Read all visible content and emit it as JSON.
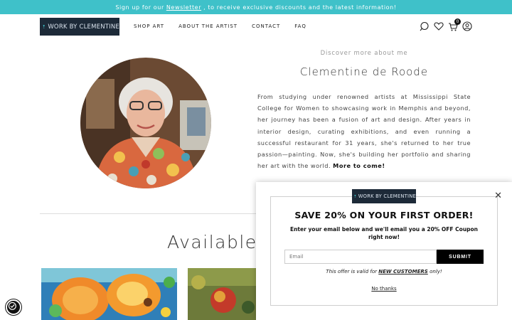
{
  "announcement": {
    "prefix": "Sign up for our",
    "link": "Newsletter",
    "suffix": ", to receive exclusive discounts and the latest information!"
  },
  "brand": {
    "logo_text": "WORK BY CLEMENTINE",
    "color": "#1d2a38"
  },
  "nav": [
    {
      "label": "SHOP ART"
    },
    {
      "label": "ABOUT THE ARTIST"
    },
    {
      "label": "CONTACT"
    },
    {
      "label": "FAQ"
    }
  ],
  "header_icons": [
    "search-icon",
    "heart-icon",
    "cart-icon",
    "account-icon"
  ],
  "cart": {
    "count": "0"
  },
  "about": {
    "eyebrow": "Discover more about me",
    "name": "Clementine de Roode",
    "bio": "From studying under renowned artists at Mississippi State College for Women to showcasing work in Memphis and beyond, her journey has been a fusion of art and design. After years in interior design, curating exhibitions, and even running a successful restaurant for 31 years, she's returned to her true passion—painting. Now, she's building her portfolio and sharing her art with the world.",
    "bio_bold": "More to come!"
  },
  "section": {
    "title": "Available"
  },
  "popup": {
    "logo_text": "WORK BY CLEMENTINE",
    "close_icon": "close-icon",
    "heading": "SAVE 20% ON YOUR FIRST ORDER!",
    "subtext": "Enter your email below and we'll email you a 20% OFF Coupon right now!",
    "email_placeholder": "Email",
    "submit_label": "SUBMIT",
    "offer_prefix": "This offer is valid for",
    "offer_bold": "NEW CUSTOMERS",
    "offer_suffix": "only!",
    "decline": "No thanks"
  },
  "colors": {
    "announce_bg": "#3fc1c9",
    "accent": "#000000"
  }
}
